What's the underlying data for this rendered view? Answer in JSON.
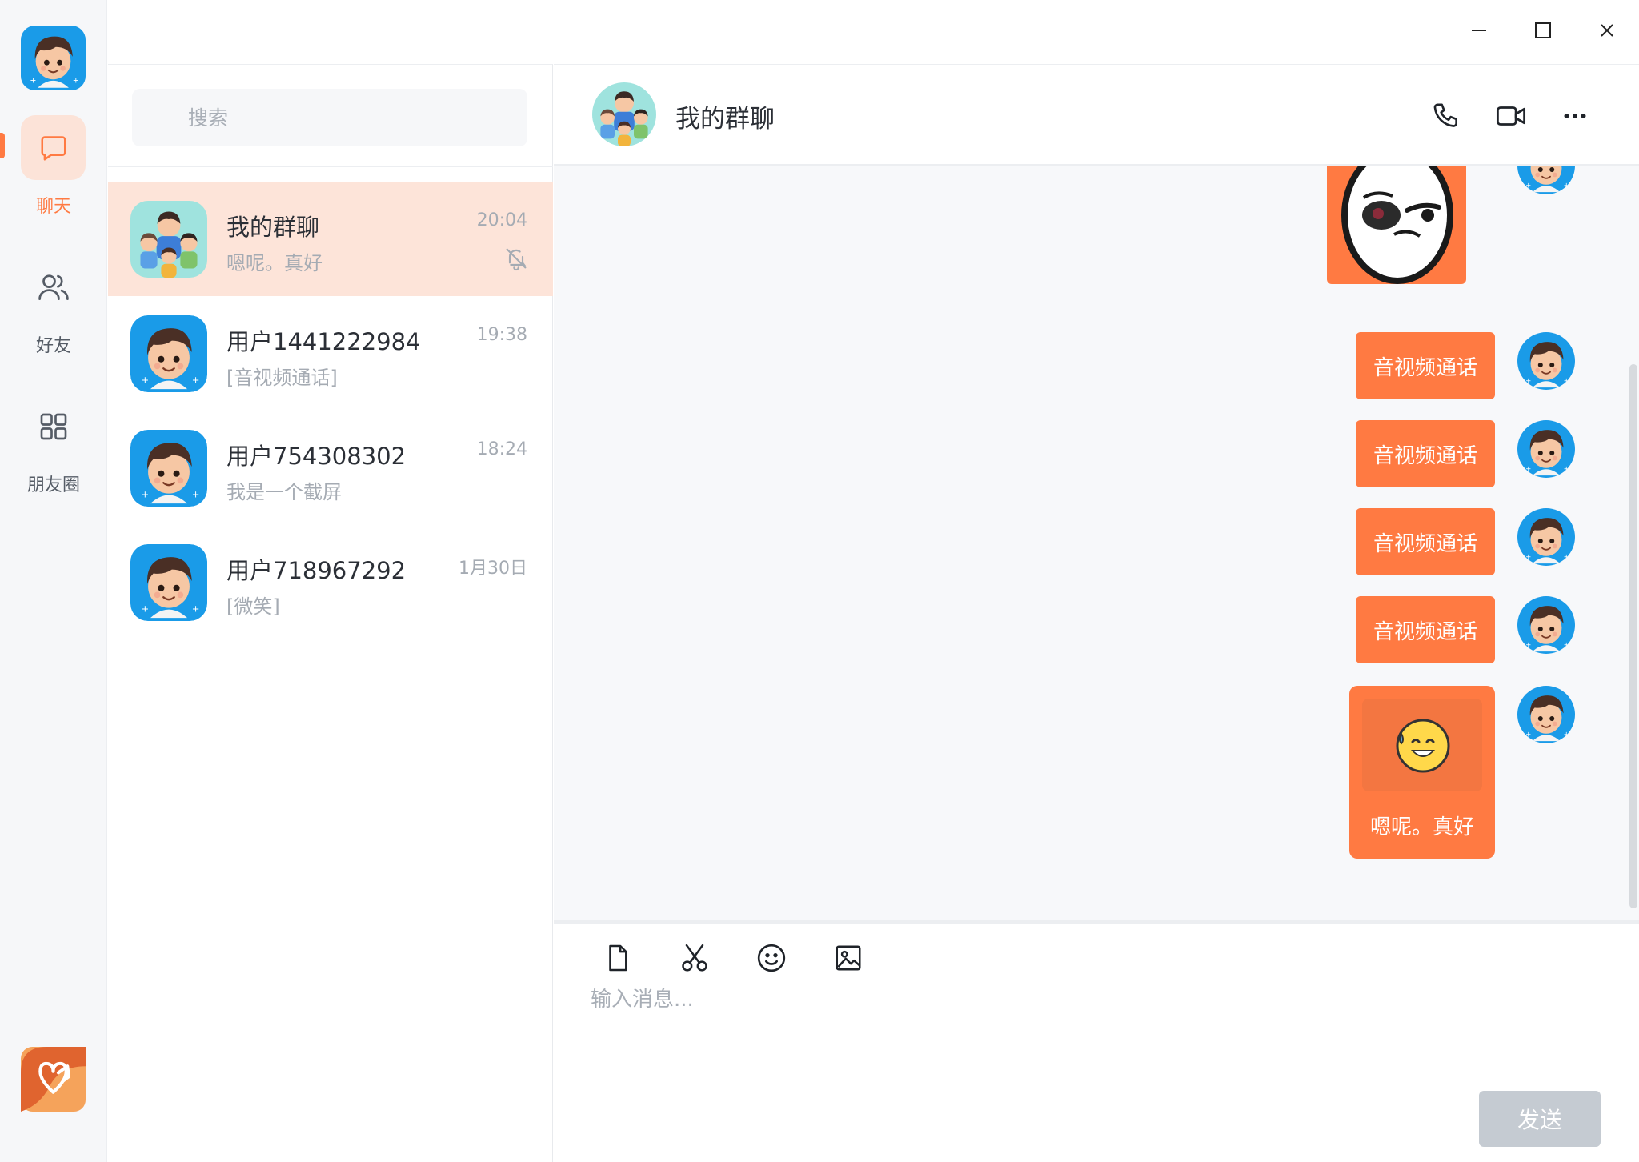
{
  "nav": {
    "items": [
      {
        "label": "聊天",
        "icon": "chat-bubble-icon",
        "active": true
      },
      {
        "label": "好友",
        "icon": "friends-icon",
        "active": false
      },
      {
        "label": "朋友圈",
        "icon": "grid-apps-icon",
        "active": false
      }
    ]
  },
  "window_controls": [
    "minimize-icon",
    "maximize-icon",
    "close-icon"
  ],
  "search": {
    "placeholder": "搜索"
  },
  "conversations": [
    {
      "name": "我的群聊",
      "time": "20:04",
      "preview": "嗯呢。真好",
      "muted": true,
      "active": true,
      "avatar": "group-avatar"
    },
    {
      "name": "用户1441222984",
      "time": "19:38",
      "preview": "[音视频通话]",
      "muted": false,
      "active": false,
      "avatar": "user-avatar"
    },
    {
      "name": "用户754308302",
      "time": "18:24",
      "preview": "我是一个截屏",
      "muted": false,
      "active": false,
      "avatar": "user-avatar"
    },
    {
      "name": "用户718967292",
      "time": "1月30日",
      "preview": "[微笑]",
      "muted": false,
      "active": false,
      "avatar": "user-avatar"
    }
  ],
  "chat": {
    "title": "我的群聊",
    "header_actions": [
      "phone-icon",
      "video-camera-icon",
      "more-dots-icon"
    ],
    "messages": [
      {
        "type": "sticker",
        "sticker": "meme-face-sticker"
      },
      {
        "type": "text",
        "text": "音视频通话"
      },
      {
        "type": "text",
        "text": "音视频通话"
      },
      {
        "type": "text",
        "text": "音视频通话"
      },
      {
        "type": "text",
        "text": "音视频通话"
      },
      {
        "type": "emoji_text",
        "emoji": "sweat-smile-emoji",
        "text": "嗯呢。真好"
      }
    ]
  },
  "composer": {
    "tools": [
      "file-icon",
      "scissors-icon",
      "emoji-icon",
      "image-icon"
    ],
    "placeholder": "输入消息...",
    "send_label": "发送"
  },
  "colors": {
    "accent": "#ff7a42",
    "active_row": "#fde4d9",
    "send_disabled": "#c5cbd2",
    "chat_bg": "#f7f8fa"
  }
}
